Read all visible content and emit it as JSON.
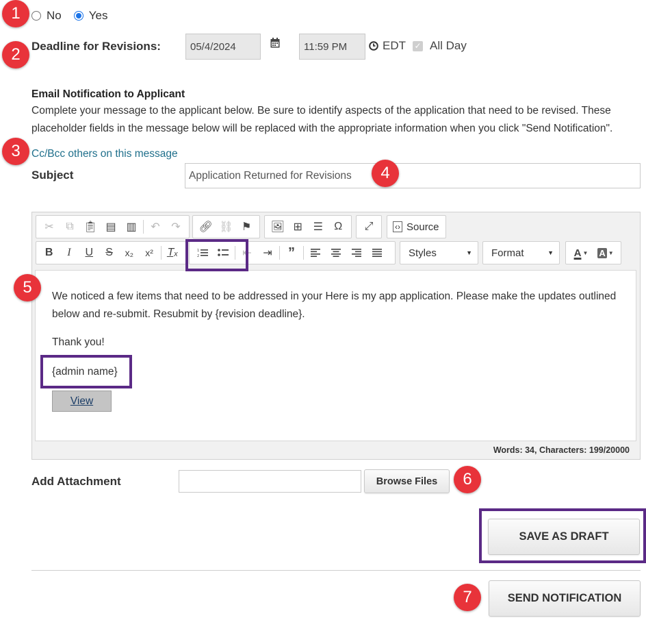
{
  "radio_group": {
    "options": [
      {
        "label": "No",
        "selected": false
      },
      {
        "label": "Yes",
        "selected": true
      }
    ]
  },
  "deadline": {
    "label": "Deadline for Revisions:",
    "date": "05/4/2024",
    "time": "11:59 PM",
    "timezone": "EDT",
    "all_day_label": "All Day",
    "all_day_checked": true
  },
  "email": {
    "heading": "Email Notification to Applicant",
    "instructions": "Complete your message to the applicant below. Be sure to identify aspects of the application that need to be revised. These placeholder fields in the message below will be replaced with the appropriate information when you click \"Send Notification\".",
    "cc_link": "Cc/Bcc others on this message",
    "subject_label": "Subject",
    "subject_value": "Application Returned for Revisions"
  },
  "editor": {
    "toolbar": {
      "source_label": "Source",
      "styles_label": "Styles",
      "format_label": "Format"
    },
    "body_paragraph": "We noticed a few items that need to be addressed in your Here is my app application. Please make the updates outlined below and re-submit. Resubmit by {revision deadline}.",
    "thanks": "Thank you!",
    "signature": "{admin name}",
    "view_button": "View",
    "word_count": "Words: 34, Characters: 199/20000"
  },
  "attachment": {
    "label": "Add Attachment",
    "browse_label": "Browse Files"
  },
  "actions": {
    "save_draft": "SAVE AS DRAFT",
    "send_notification": "SEND NOTIFICATION"
  },
  "callouts": [
    "1",
    "2",
    "3",
    "4",
    "5",
    "6",
    "7"
  ],
  "colors": {
    "callout": "#e8333a",
    "highlight": "#5b2a86",
    "radio_selected": "#1a73e8",
    "link": "#1f6f8b"
  }
}
